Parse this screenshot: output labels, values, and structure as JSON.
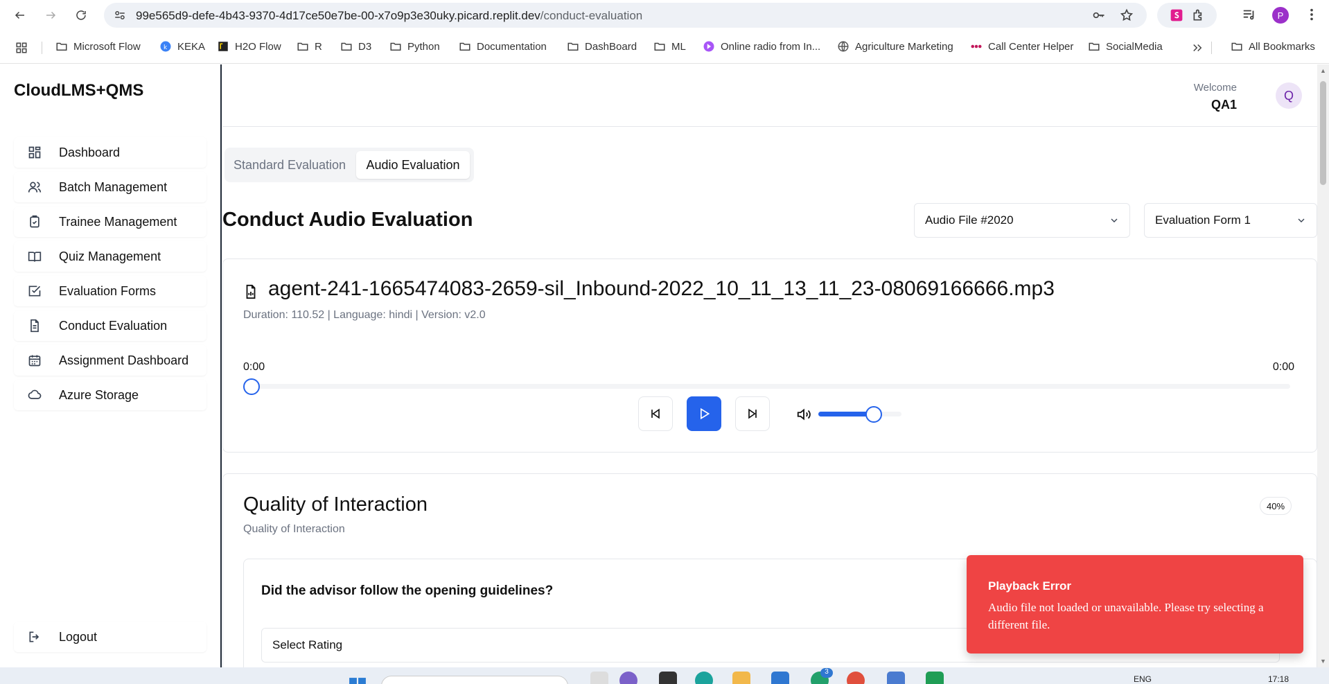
{
  "browser": {
    "url_host": "99e565d9-defe-4b43-9370-4d17ce50e7be-00-x7o9p3e30uky.picard.replit.dev",
    "url_path": "/conduct-evaluation",
    "bookmarks": [
      {
        "label": "Microsoft Flow",
        "icon": "folder-icon"
      },
      {
        "label": "KEKA",
        "icon": "keka-icon"
      },
      {
        "label": "H2O Flow",
        "icon": "h2o-icon"
      },
      {
        "label": "R",
        "icon": "folder-icon"
      },
      {
        "label": "D3",
        "icon": "folder-icon"
      },
      {
        "label": "Python",
        "icon": "folder-icon"
      },
      {
        "label": "Documentation",
        "icon": "folder-icon"
      },
      {
        "label": "DashBoard",
        "icon": "folder-icon"
      },
      {
        "label": "ML",
        "icon": "folder-icon"
      },
      {
        "label": "Online radio from In...",
        "icon": "radio-icon"
      },
      {
        "label": "Agriculture Marketing",
        "icon": "globe-icon"
      },
      {
        "label": "Call Center Helper",
        "icon": "dots-icon"
      },
      {
        "label": "SocialMedia",
        "icon": "folder-icon"
      }
    ],
    "all_bookmarks_label": "All Bookmarks",
    "profile_initial": "P"
  },
  "app": {
    "brand": "CloudLMS+QMS",
    "nav": [
      {
        "label": "Dashboard",
        "icon": "dashboard-grid-icon"
      },
      {
        "label": "Batch Management",
        "icon": "users-icon"
      },
      {
        "label": "Trainee Management",
        "icon": "clipboard-check-icon"
      },
      {
        "label": "Quiz Management",
        "icon": "book-open-icon"
      },
      {
        "label": "Evaluation Forms",
        "icon": "checkbox-icon"
      },
      {
        "label": "Conduct Evaluation",
        "icon": "file-text-icon"
      },
      {
        "label": "Assignment Dashboard",
        "icon": "calendar-icon"
      },
      {
        "label": "Azure Storage",
        "icon": "cloud-icon"
      }
    ],
    "logout_label": "Logout"
  },
  "header": {
    "welcome": "Welcome",
    "user_name": "QA1",
    "avatar_initial": "Q"
  },
  "tabs": {
    "standard": "Standard Evaluation",
    "audio": "Audio Evaluation",
    "active": "audio"
  },
  "page": {
    "title": "Conduct Audio Evaluation",
    "audio_file_select": "Audio File #2020",
    "form_select": "Evaluation Form 1"
  },
  "player": {
    "file_name": "agent-241-1665474083-2659-sil_Inbound-2022_10_11_13_11_23-08069166666.mp3",
    "meta": "Duration: 110.52 | Language: hindi | Version: v2.0",
    "current_time": "0:00",
    "total_time": "0:00",
    "progress": 0,
    "volume": 0.67
  },
  "section": {
    "title": "Quality of Interaction",
    "subtitle": "Quality of Interaction",
    "weight": "40%",
    "question": "Did the advisor follow the opening guidelines?",
    "rating_placeholder": "Select Rating"
  },
  "toast": {
    "title": "Playback Error",
    "message": "Audio file not loaded or unavailable. Please try selecting a different file."
  },
  "taskbar": {
    "language": "ENG",
    "time": "17:18",
    "badge_count": "3"
  },
  "colors": {
    "accent": "#2563eb",
    "error": "#ef4444",
    "avatar_bg": "#ede4f7"
  }
}
